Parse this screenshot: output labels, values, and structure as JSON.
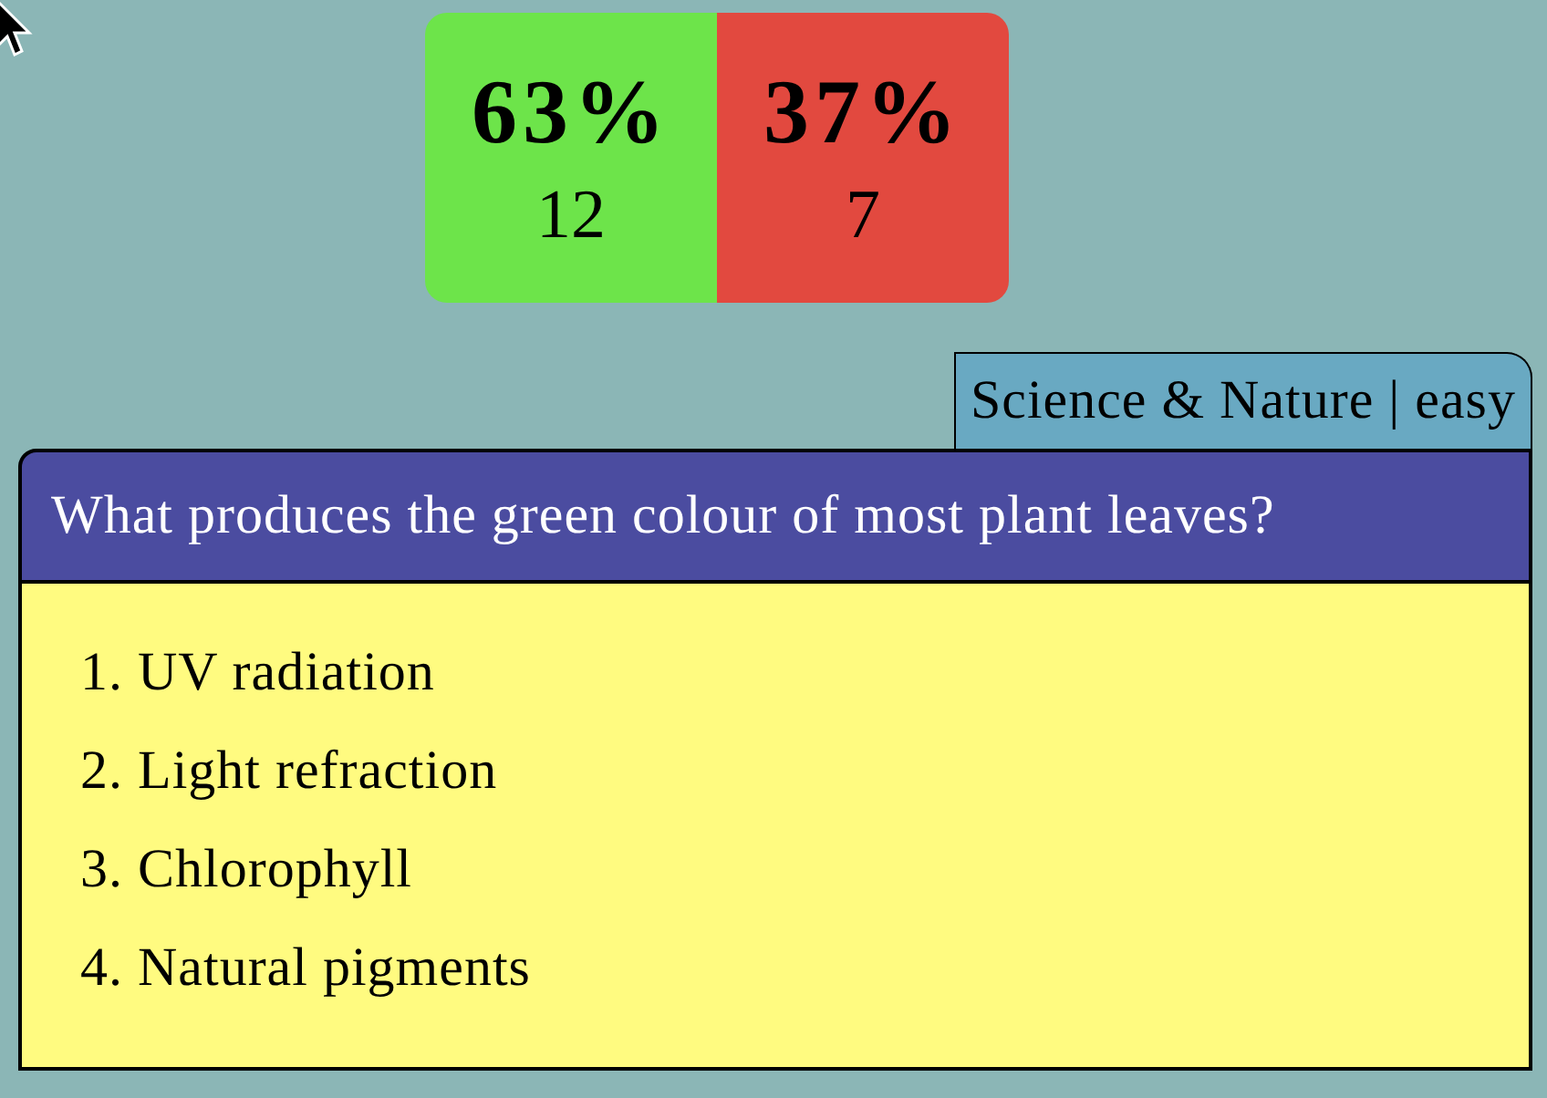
{
  "results": [
    {
      "kind": "correct",
      "percent": "63%",
      "count": "12"
    },
    {
      "kind": "wrong",
      "percent": "37%",
      "count": "7"
    }
  ],
  "question": {
    "category": "Science & Nature | easy",
    "text": "What produces the green colour of most plant leaves?",
    "answers": [
      {
        "number": "1.",
        "text": "UV radiation"
      },
      {
        "number": "2.",
        "text": "Light refraction"
      },
      {
        "number": "3.",
        "text": "Chlorophyll"
      },
      {
        "number": "4.",
        "text": "Natural pigments"
      }
    ]
  }
}
